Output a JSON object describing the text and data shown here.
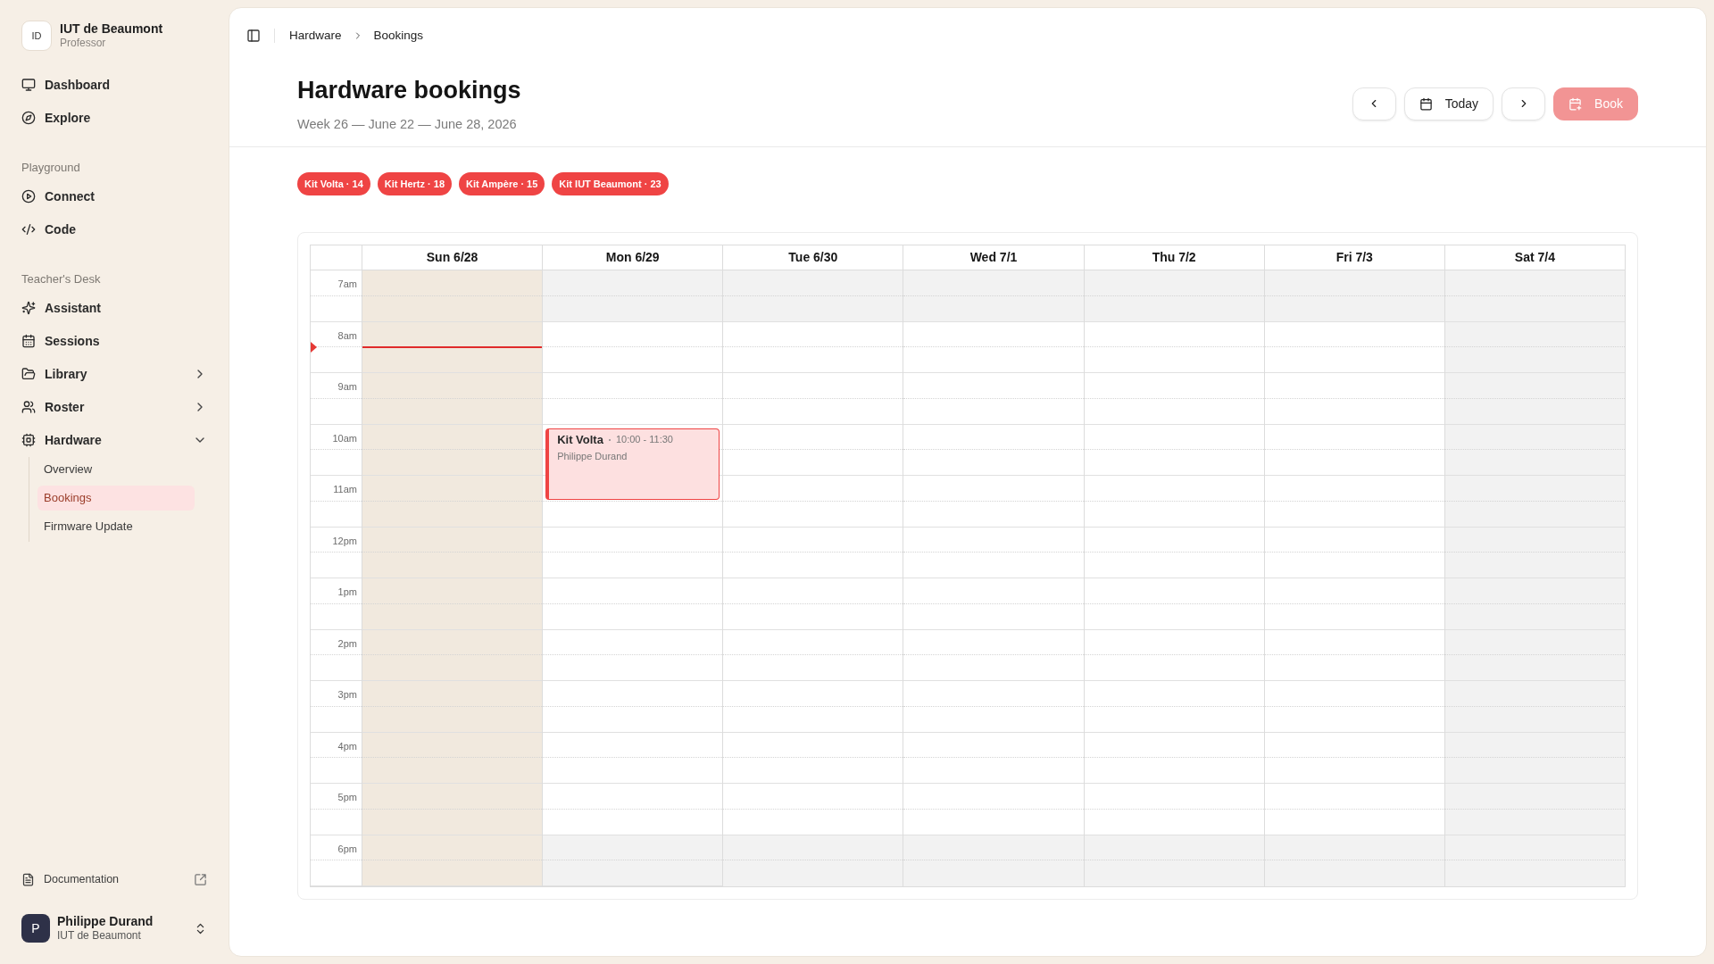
{
  "sidebar": {
    "org": {
      "initials": "ID",
      "name": "IUT de Beaumont",
      "role": "Professor"
    },
    "sections": [
      {
        "items": [
          {
            "label": "Dashboard",
            "selected": false
          },
          {
            "label": "Explore",
            "selected": false
          }
        ]
      },
      {
        "heading": "Playground",
        "items": [
          {
            "label": "Connect",
            "selected": false
          },
          {
            "label": "Code",
            "selected": false
          }
        ]
      },
      {
        "heading": "Teacher's Desk",
        "items": [
          {
            "label": "Assistant",
            "selected": false
          },
          {
            "label": "Sessions",
            "selected": false
          },
          {
            "label": "Library",
            "selected": false,
            "expanded": false
          },
          {
            "label": "Roster",
            "selected": false,
            "expanded": false
          },
          {
            "label": "Hardware",
            "selected": false,
            "expanded": true,
            "children": [
              {
                "label": "Overview",
                "selected": false
              },
              {
                "label": "Bookings",
                "selected": true
              },
              {
                "label": "Firmware Update",
                "selected": false
              }
            ]
          }
        ]
      }
    ],
    "footer_link": {
      "label": "Documentation"
    },
    "user": {
      "initial": "P",
      "name": "Philippe Durand",
      "org": "IUT de Beaumont"
    }
  },
  "breadcrumb": [
    "Hardware",
    "Bookings"
  ],
  "header": {
    "title": "Hardware bookings",
    "subtitle": "Week 26 — June 22 — June 28, 2026",
    "today_button": {
      "label": "Today"
    },
    "book_button": {
      "label": "Book",
      "disabled": true
    }
  },
  "kits": [
    {
      "label": "Kit Volta · 14"
    },
    {
      "label": "Kit Hertz · 18"
    },
    {
      "label": "Kit Ampère · 15"
    },
    {
      "label": "Kit IUT Beaumont · 23"
    }
  ],
  "calendar": {
    "days": [
      {
        "label": "Sun 6/28",
        "kind": "today"
      },
      {
        "label": "Mon 6/29",
        "kind": "open",
        "events": [
          {
            "title": "Kit Volta",
            "time": "10:00 - 11:30",
            "person": "Philippe Durand"
          }
        ]
      },
      {
        "label": "Tue 6/30",
        "kind": "open"
      },
      {
        "label": "Wed 7/1",
        "kind": "open"
      },
      {
        "label": "Thu 7/2",
        "kind": "open"
      },
      {
        "label": "Fri 7/3",
        "kind": "open"
      },
      {
        "label": "Sat 7/4",
        "kind": "closed"
      }
    ],
    "hours": [
      {
        "label": "7am",
        "kind": "closed",
        "now": false
      },
      {
        "label": "8am",
        "kind": "open",
        "now": true
      },
      {
        "label": "9am",
        "kind": "open",
        "now": false
      },
      {
        "label": "10am",
        "kind": "open",
        "now": false
      },
      {
        "label": "11am",
        "kind": "open",
        "now": false
      },
      {
        "label": "12pm",
        "kind": "open",
        "now": false
      },
      {
        "label": "1pm",
        "kind": "open",
        "now": false
      },
      {
        "label": "2pm",
        "kind": "open",
        "now": false
      },
      {
        "label": "3pm",
        "kind": "open",
        "now": false
      },
      {
        "label": "4pm",
        "kind": "open",
        "now": false
      },
      {
        "label": "5pm",
        "kind": "open",
        "now": false
      },
      {
        "label": "6pm",
        "kind": "closed",
        "now": false
      }
    ]
  }
}
